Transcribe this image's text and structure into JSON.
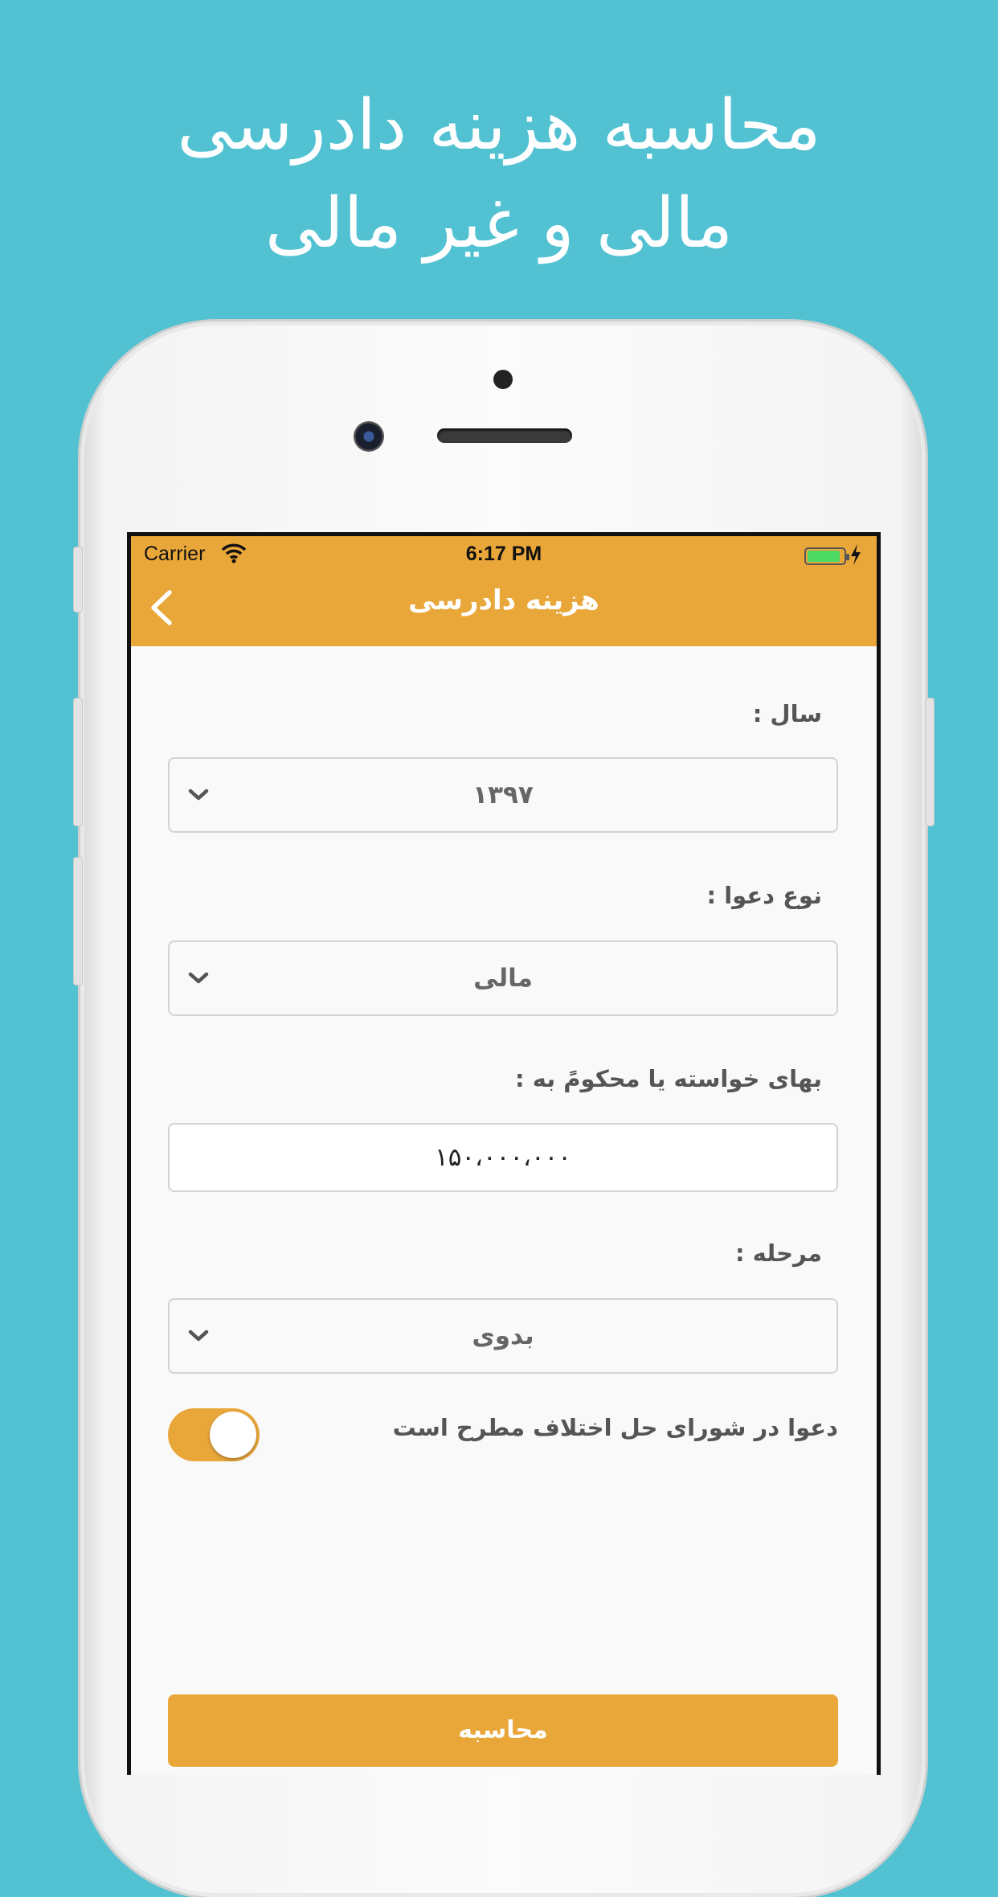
{
  "headline": {
    "line1": "محاسبه هزینه دادرسی",
    "line2": "مالی و غیر مالی"
  },
  "status_bar": {
    "carrier": "Carrier",
    "time": "6:17 PM"
  },
  "navbar": {
    "title": "هزینه دادرسی",
    "back_icon": "chevron-left-icon"
  },
  "form": {
    "year": {
      "label": "سال :",
      "value": "۱۳۹۷"
    },
    "claim_type": {
      "label": "نوع دعوا :",
      "value": "مالی"
    },
    "amount": {
      "label": "بهای خواسته یا محکومً به :",
      "value": "۱۵۰،۰۰۰،۰۰۰"
    },
    "stage": {
      "label": "مرحله :",
      "value": "بدوی"
    },
    "council_toggle": {
      "label": "دعوا در شورای حل اختلاف مطرح است",
      "on": true
    },
    "submit_label": "محاسبه"
  },
  "colors": {
    "background": "#52c2d3",
    "accent": "#e9a73a",
    "battery": "#4cd964"
  }
}
